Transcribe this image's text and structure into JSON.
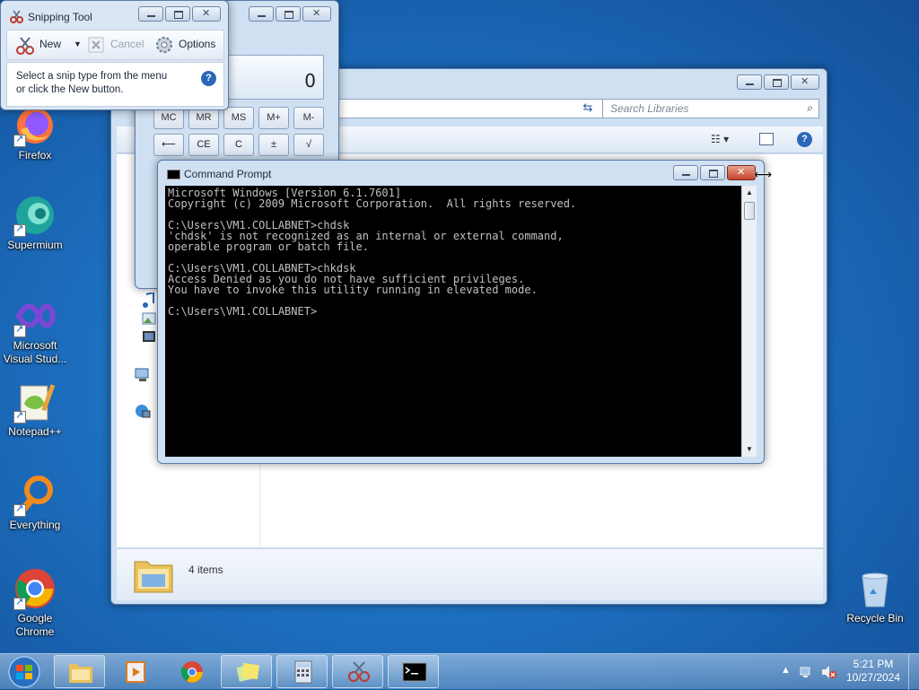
{
  "desktop": {
    "icons": [
      {
        "label": "Firefox"
      },
      {
        "label": "Supermium"
      },
      {
        "label": "Microsoft Visual Stud..."
      },
      {
        "label": "Notepad++"
      },
      {
        "label": "Everything"
      },
      {
        "label": "Google Chrome"
      },
      {
        "label": "Recycle Bin"
      }
    ]
  },
  "snipping_tool": {
    "title": "Snipping Tool",
    "toolbar": {
      "new_label": "New",
      "cancel_label": "Cancel",
      "options_label": "Options"
    },
    "message_line1": "Select a snip type from the menu",
    "message_line2": "or click the New button.",
    "help_glyph": "?"
  },
  "calculator": {
    "display_value": "0",
    "rows": [
      [
        "MC",
        "MR",
        "MS",
        "M+",
        "M-"
      ],
      [
        "⟵",
        "CE",
        "C",
        "±",
        "√"
      ]
    ]
  },
  "explorer": {
    "search_placeholder": "Search Libraries",
    "status_items": "4 items"
  },
  "command_prompt": {
    "title": "Command Prompt",
    "lines": [
      "Microsoft Windows [Version 6.1.7601]",
      "Copyright (c) 2009 Microsoft Corporation.  All rights reserved.",
      "",
      "C:\\Users\\VM1.COLLABNET>chdsk",
      "'chdsk' is not recognized as an internal or external command,",
      "operable program or batch file.",
      "",
      "C:\\Users\\VM1.COLLABNET>chkdsk",
      "Access Denied as you do not have sufficient privileges.",
      "You have to invoke this utility running in elevated mode.",
      "",
      "C:\\Users\\VM1.COLLABNET>"
    ]
  },
  "taskbar": {
    "time": "5:21 PM",
    "date": "10/27/2024",
    "pinned": [
      "explorer",
      "media-player",
      "chrome",
      "sticky-notes",
      "calculator",
      "snipping-tool",
      "command-prompt"
    ]
  },
  "colors": {
    "desktop_bg": "#1d6fbf",
    "console_bg": "#000000",
    "console_text": "#c0c0c0",
    "close_red": "#c4432b"
  }
}
